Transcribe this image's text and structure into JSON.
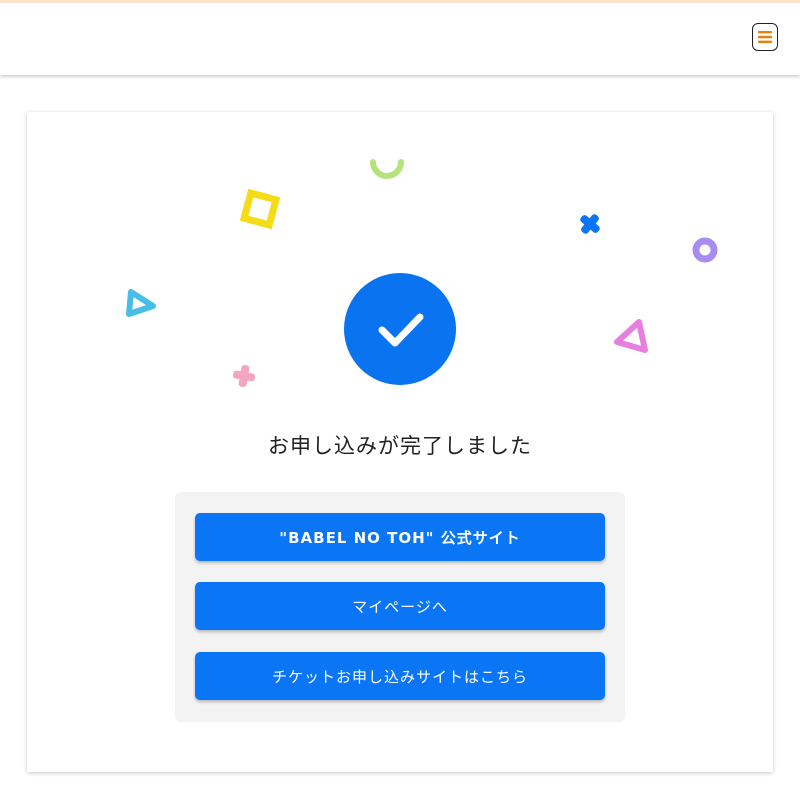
{
  "header": {
    "menu_icon": "hamburger-menu-icon",
    "accent_color": "#e8820c"
  },
  "completion": {
    "icon": "check-circle-icon",
    "message": "お申し込みが完了しました"
  },
  "buttons": [
    {
      "label": "\"BABEL NO TOH\" 公式サイト"
    },
    {
      "label": "マイページへ"
    },
    {
      "label": "チケットお申し込みサイトはこちら"
    }
  ],
  "colors": {
    "primary": "#0a76f6",
    "panel": "#f3f3f3"
  }
}
